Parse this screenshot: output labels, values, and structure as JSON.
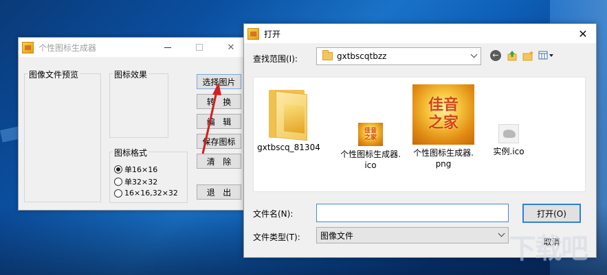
{
  "desktop": {},
  "app_window": {
    "title": "个性图标生成器",
    "preview_group_label": "图像文件预览",
    "effect_group_label": "图标效果",
    "format_group_label": "图标格式",
    "format_options": [
      {
        "label": "单16×16",
        "checked": true
      },
      {
        "label": "单32×32",
        "checked": false
      },
      {
        "label": "16×16,32×32",
        "checked": false
      }
    ],
    "buttons": {
      "select_image": "选择图片",
      "convert": "转   换",
      "edit": "编   辑",
      "save_icon": "保存图标",
      "clear": "清   除",
      "exit": "退   出"
    }
  },
  "open_dialog": {
    "title": "打开",
    "look_in_label": "查找范围(I):",
    "look_in_value": "gxtbscqtbzz",
    "files": [
      {
        "name": "gxtbscq_81304",
        "type": "folder"
      },
      {
        "name": "个性图标生成器.\nico",
        "type": "ico",
        "thumb_text": [
          "佳音",
          "之家"
        ]
      },
      {
        "name": "个性图标生成器.\npng",
        "type": "png",
        "thumb_text": [
          "佳音",
          "之家"
        ]
      },
      {
        "name": "实例.ico",
        "type": "ico-horse"
      }
    ],
    "filename_label": "文件名(N):",
    "filename_value": "",
    "filetype_label": "文件类型(T):",
    "filetype_value": "图像文件",
    "open_button": "打开(O)",
    "cancel_button": "取消"
  },
  "watermark_text": "下载吧"
}
